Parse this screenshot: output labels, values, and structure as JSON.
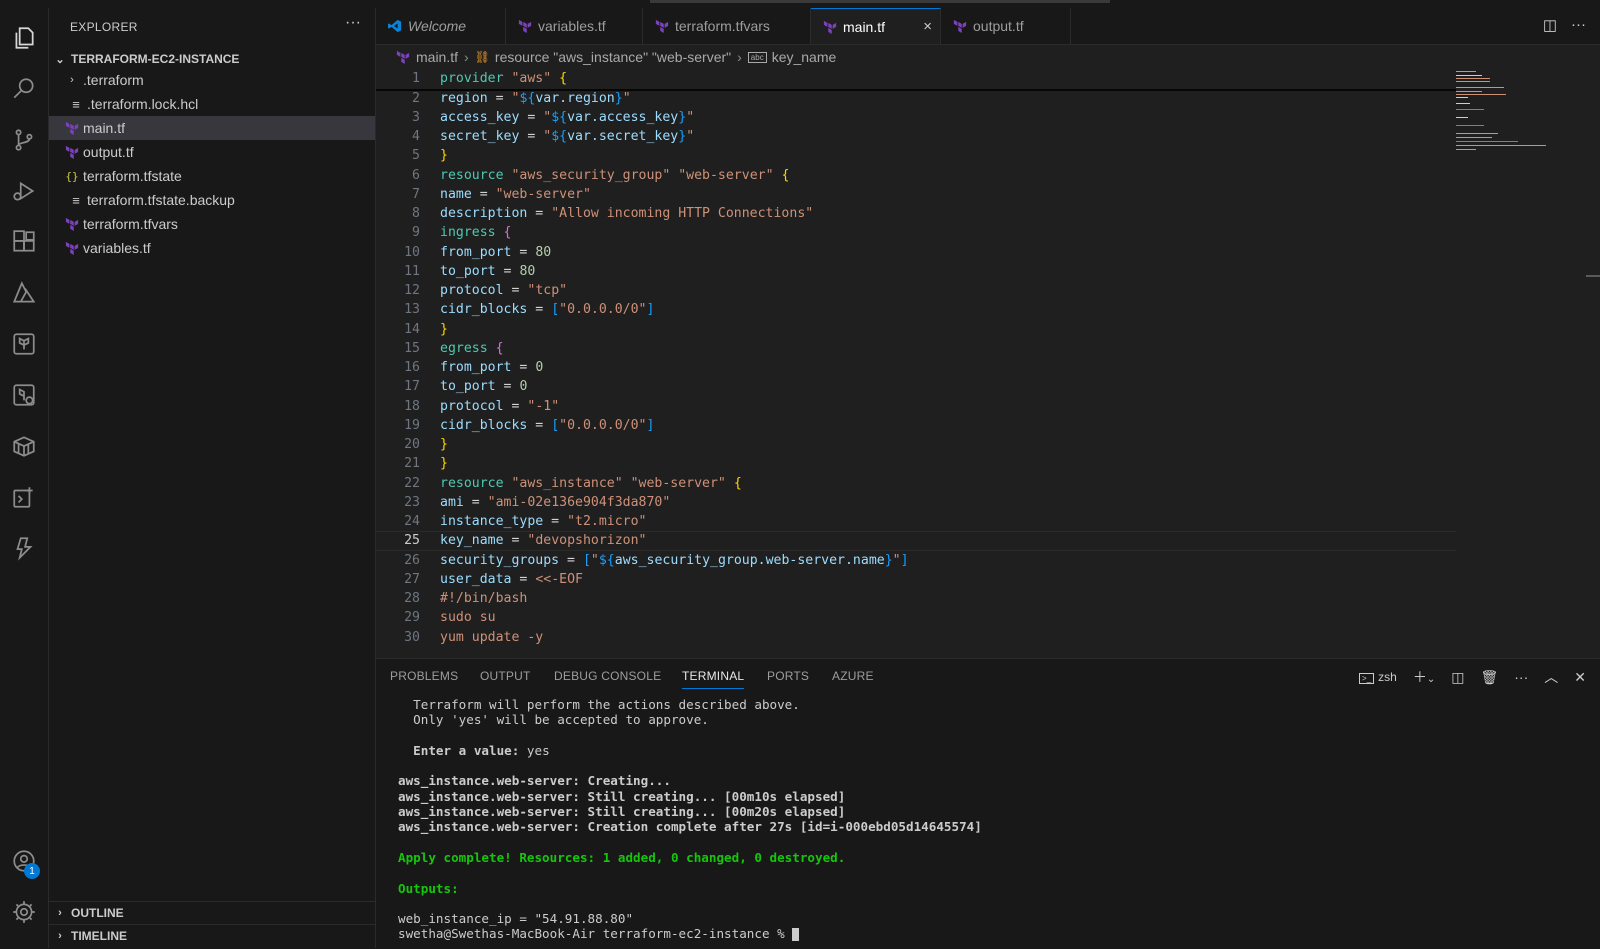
{
  "explorer": {
    "header": "EXPLORER",
    "folder": "TERRAFORM-EC2-INSTANCE",
    "items": [
      {
        "label": ".terraform",
        "icon": "chevron-right-icon"
      },
      {
        "label": ".terraform.lock.hcl",
        "icon": "lines-icon"
      },
      {
        "label": "main.tf",
        "icon": "terraform-icon"
      },
      {
        "label": "output.tf",
        "icon": "terraform-icon"
      },
      {
        "label": "terraform.tfstate",
        "icon": "json-icon"
      },
      {
        "label": "terraform.tfstate.backup",
        "icon": "lines-icon"
      },
      {
        "label": "terraform.tfvars",
        "icon": "terraform-icon"
      },
      {
        "label": "variables.tf",
        "icon": "terraform-icon"
      }
    ],
    "outline": "OUTLINE",
    "timeline": "TIMELINE"
  },
  "tabs": [
    {
      "label": "Welcome"
    },
    {
      "label": "variables.tf"
    },
    {
      "label": "terraform.tfvars"
    },
    {
      "label": "main.tf",
      "close": "×"
    },
    {
      "label": "output.tf"
    }
  ],
  "breadcrumb": {
    "file": "main.tf",
    "symbol": "resource \"aws_instance\" \"web-server\"",
    "field": "key_name"
  },
  "code": [
    "provider \"aws\" {",
    "region = \"${var.region}\"",
    "access_key = \"${var.access_key}\"",
    "secret_key = \"${var.secret_key}\"",
    "}",
    "resource \"aws_security_group\" \"web-server\" {",
    "name = \"web-server\"",
    "description = \"Allow incoming HTTP Connections\"",
    "ingress {",
    "from_port = 80",
    "to_port = 80",
    "protocol = \"tcp\"",
    "cidr_blocks = [\"0.0.0.0/0\"]",
    "}",
    "egress {",
    "from_port = 0",
    "to_port = 0",
    "protocol = \"-1\"",
    "cidr_blocks = [\"0.0.0.0/0\"]",
    "}",
    "}",
    "resource \"aws_instance\" \"web-server\" {",
    "ami = \"ami-02e136e904f3da870\"",
    "instance_type = \"t2.micro\"",
    "key_name = \"devopshorizon\"",
    "security_groups = [\"${aws_security_group.web-server.name}\"]",
    "user_data = <<-EOF",
    "#!/bin/bash",
    "sudo su",
    "yum update -y"
  ],
  "line_numbers": [
    "1",
    "2",
    "3",
    "4",
    "5",
    "6",
    "7",
    "8",
    "9",
    "10",
    "11",
    "12",
    "13",
    "14",
    "15",
    "16",
    "17",
    "18",
    "19",
    "20",
    "21",
    "22",
    "23",
    "24",
    "25",
    "26",
    "27",
    "28",
    "29",
    "30"
  ],
  "current_line": 25,
  "panel": {
    "tabs": [
      "PROBLEMS",
      "OUTPUT",
      "DEBUG CONSOLE",
      "TERMINAL",
      "PORTS",
      "AZURE"
    ],
    "active_tab": "TERMINAL",
    "shell": "zsh"
  },
  "terminal": [
    "  Terraform will perform the actions described above.",
    "  Only 'yes' will be accepted to approve.",
    "",
    "  Enter a value: yes",
    "",
    "aws_instance.web-server: Creating...",
    "aws_instance.web-server: Still creating... [00m10s elapsed]",
    "aws_instance.web-server: Still creating... [00m20s elapsed]",
    "aws_instance.web-server: Creation complete after 27s [id=i-000ebd05d14645574]",
    "",
    "Apply complete! Resources: 1 added, 0 changed, 0 destroyed.",
    "",
    "Outputs:",
    "",
    "web_instance_ip = \"54.91.88.80\"",
    "swetha@Swethas-MacBook-Air terraform-ec2-instance % "
  ],
  "account_badge": "1",
  "colors": {
    "accent": "#0078d4",
    "success": "#16c60c",
    "terraform": "#7b42bc"
  }
}
